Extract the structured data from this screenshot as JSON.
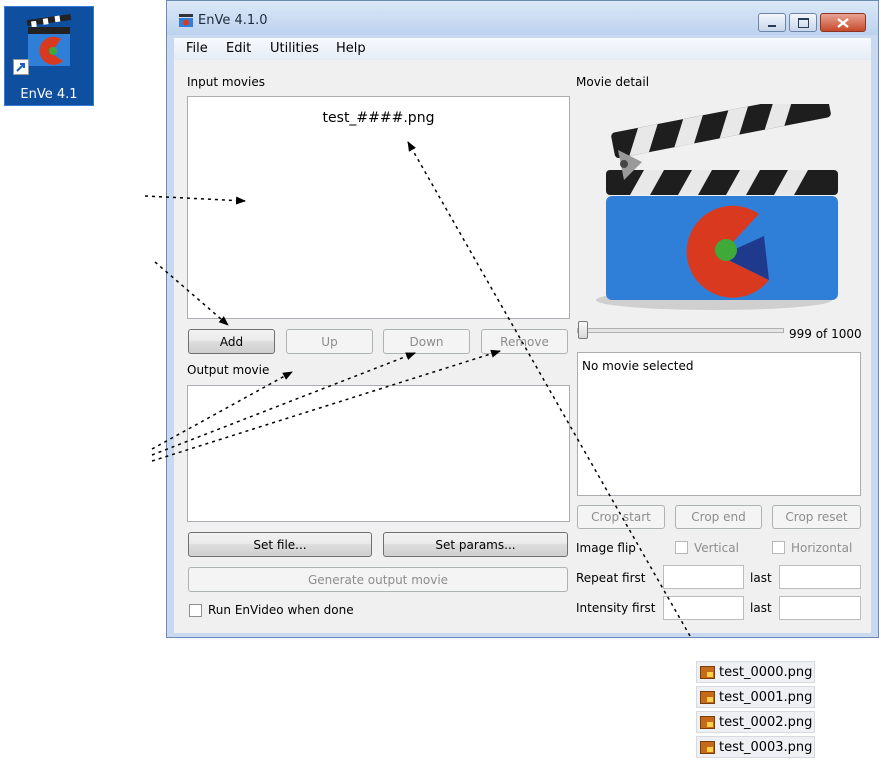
{
  "desktop_icon": {
    "label": "EnVe 4.1"
  },
  "window": {
    "title": "EnVe 4.1.0"
  },
  "menu": [
    "File",
    "Edit",
    "Utilities",
    "Help"
  ],
  "input_movies": {
    "label": "Input movies",
    "items": [
      "test_####.png"
    ]
  },
  "buttons": {
    "add": "Add",
    "up": "Up",
    "down": "Down",
    "remove": "Remove"
  },
  "output_movie": {
    "label": "Output movie",
    "set_file": "Set file...",
    "set_params": "Set params...",
    "generate": "Generate output movie",
    "run_label": "Run EnVideo when done"
  },
  "movie_detail": {
    "label": "Movie detail",
    "frame_counter": "999 of 1000",
    "frame_fraction": 0.999,
    "info": "No movie selected"
  },
  "crop": {
    "start": "Crop start",
    "end": "Crop end",
    "reset": "Crop reset"
  },
  "image_flip": {
    "label": "Image flip",
    "vertical": "Vertical",
    "horizontal": "Horizontal"
  },
  "repeat": {
    "label": "Repeat first",
    "last": "last"
  },
  "intensity": {
    "label": "Intensity first",
    "last": "last"
  },
  "files": [
    "test_0000.png",
    "test_0001.png",
    "test_0002.png",
    "test_0003.png"
  ],
  "colors": {
    "clapper_blue": "#2f7fd8",
    "logo_red": "#d93a1f",
    "logo_navy": "#1f3a8c",
    "logo_green": "#3faa3a"
  }
}
